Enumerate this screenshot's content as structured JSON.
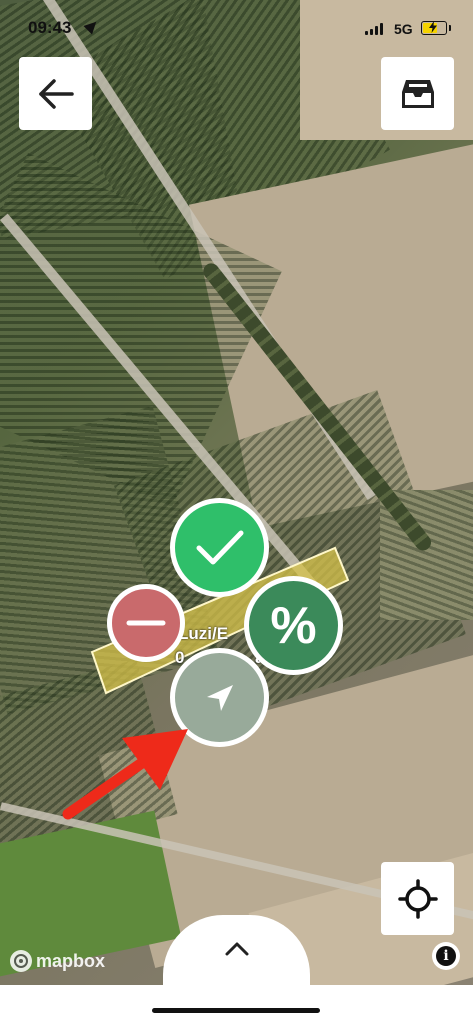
{
  "status_bar": {
    "time": "09:43",
    "network": "5G"
  },
  "top_bar": {
    "back_icon": "arrow-left-icon",
    "inbox_icon": "inbox-tray-icon"
  },
  "map": {
    "field_label_line1": "Luzi/E",
    "field_label_line2": "0",
    "field_label_line2_suffix": "a",
    "highlight_color": "#d6c24a"
  },
  "radial_menu": {
    "confirm_icon": "checkmark-icon",
    "confirm_color": "#2fbf6a",
    "remove_icon": "minus-icon",
    "remove_color": "#c96a6c",
    "percent_label": "%",
    "percent_color": "#3b8a5a",
    "navigate_icon": "navigation-arrow-icon",
    "navigate_color": "#98aa9a"
  },
  "locate_button_icon": "crosshair-icon",
  "bottom_sheet": {
    "handle_icon": "chevron-up-icon"
  },
  "attribution": {
    "brand": "mapbox",
    "info_label": "i"
  },
  "annotation": {
    "arrow_color": "#ee2a1a"
  }
}
